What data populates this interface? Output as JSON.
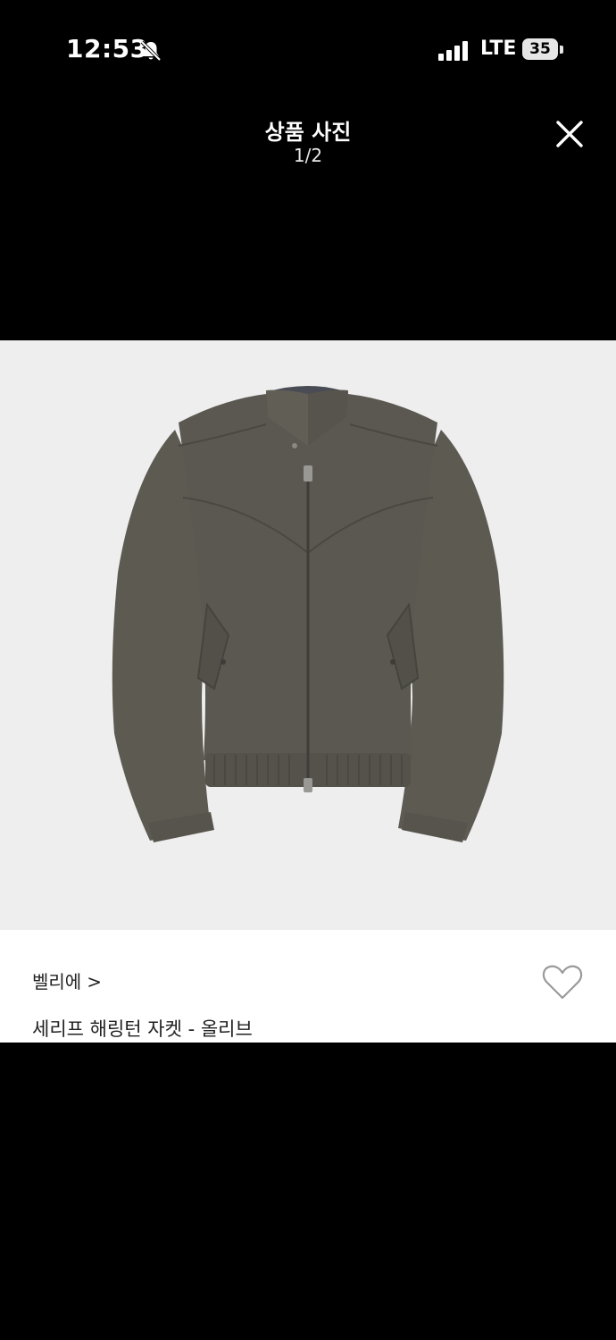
{
  "status_bar": {
    "time": "12:53",
    "network": "LTE",
    "battery": "35",
    "icons": [
      "bell-slash-icon",
      "signal-icon",
      "battery-icon"
    ]
  },
  "header": {
    "title": "상품 사진",
    "page_counter": "1/2",
    "close_icon": "close-icon"
  },
  "photo": {
    "subject": "jacket"
  },
  "product": {
    "brand": "벨리에",
    "brand_chevron": ">",
    "name": "세리프 해링턴 자켓 - 올리브",
    "like_icon": "heart-icon"
  },
  "colors": {
    "background": "#000000",
    "photo_background": "#eeeeee",
    "jacket": "#5b5851",
    "card_background": "#ffffff",
    "text_dark": "#222222"
  }
}
